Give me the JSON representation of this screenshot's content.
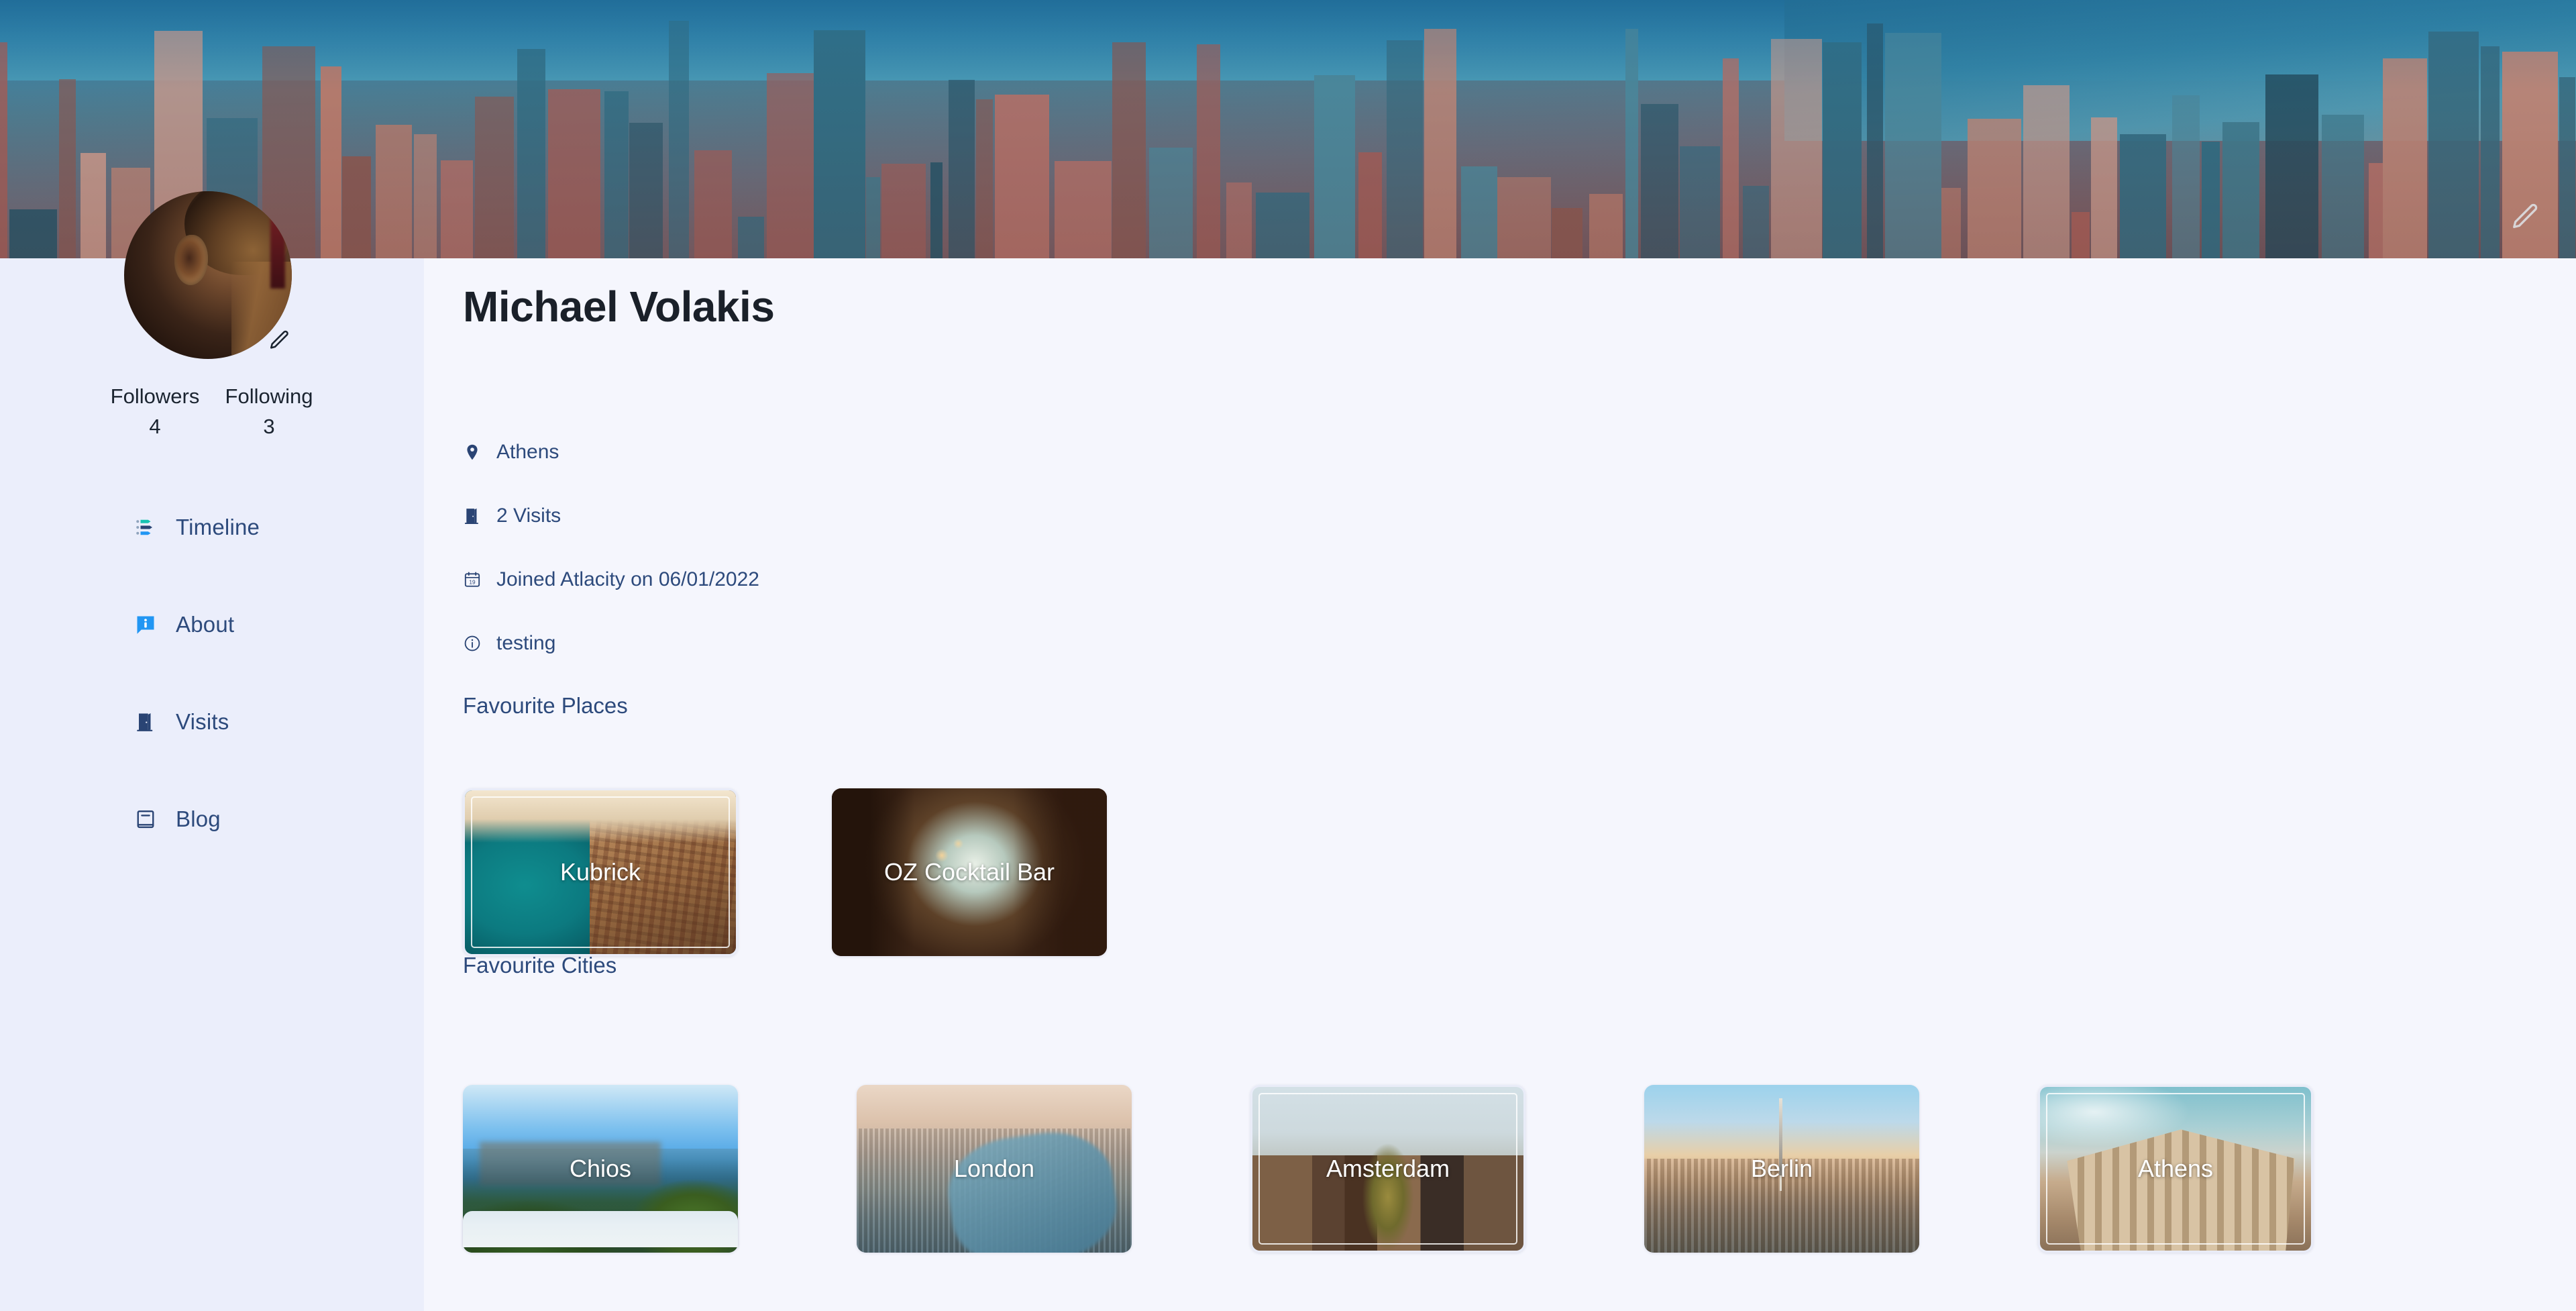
{
  "cover": {
    "edit_icon": "pencil-icon"
  },
  "profile": {
    "name": "Michael Volakis",
    "avatar_edit_icon": "pencil-icon",
    "stats": [
      {
        "label": "Followers",
        "value": "4"
      },
      {
        "label": "Following",
        "value": "3"
      }
    ]
  },
  "sidebar": {
    "items": [
      {
        "label": "Timeline",
        "icon": "timeline-icon"
      },
      {
        "label": "About",
        "icon": "info-bubble-icon"
      },
      {
        "label": "Visits",
        "icon": "door-icon"
      },
      {
        "label": "Blog",
        "icon": "book-icon"
      }
    ]
  },
  "meta": [
    {
      "icon": "location-pin-icon",
      "text": "Athens"
    },
    {
      "icon": "door-icon",
      "text": "2 Visits"
    },
    {
      "icon": "calendar-icon",
      "text": "Joined Atlacity on 06/01/2022"
    },
    {
      "icon": "info-circle-icon",
      "text": "testing"
    }
  ],
  "sections": {
    "places": {
      "title": "Favourite Places",
      "cards": [
        {
          "name": "Kubrick",
          "art": "img-kubrick",
          "framed": true
        },
        {
          "name": "OZ Cocktail Bar",
          "art": "img-oz",
          "framed": false
        }
      ]
    },
    "cities": {
      "title": "Favourite Cities",
      "cards": [
        {
          "name": "Chios",
          "art": "img-chios",
          "framed": false
        },
        {
          "name": "London",
          "art": "img-london",
          "framed": false
        },
        {
          "name": "Amsterdam",
          "art": "img-amsterdam",
          "framed": true
        },
        {
          "name": "Berlin",
          "art": "img-berlin",
          "framed": false
        },
        {
          "name": "Athens",
          "art": "img-athens",
          "framed": true
        }
      ],
      "overflow_cards": [
        {
          "name": "",
          "art": "img-extra",
          "framed": false
        }
      ]
    }
  },
  "colors": {
    "sidebar_bg": "#ebeefb",
    "main_bg": "#f5f6fd",
    "nav_text": "#2d4a7c",
    "heading": "#2d4a7c",
    "name": "#1a2029",
    "accent_blue": "#2196f3",
    "accent_teal": "#17c3b2",
    "navy": "#2a4474"
  }
}
